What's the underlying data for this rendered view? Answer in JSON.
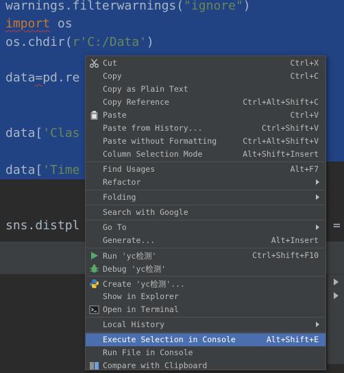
{
  "editor": {
    "lines": [
      {
        "parts": [
          {
            "t": "warnings.filterwarnings(",
            "c": ""
          },
          {
            "t": "\"ignore\"",
            "c": "str"
          },
          {
            "t": ")",
            "c": ""
          }
        ]
      },
      {
        "parts": [
          {
            "t": "import",
            "c": "kw"
          },
          {
            "t": " os",
            "c": ""
          }
        ]
      },
      {
        "parts": [
          {
            "t": "os.chdir(",
            "c": ""
          },
          {
            "t": "r'C:/Data'",
            "c": "str"
          },
          {
            "t": ")",
            "c": ""
          }
        ]
      },
      {
        "parts": [
          {
            "t": "data",
            "c": ""
          },
          {
            "t": "=",
            "c": "squig"
          },
          {
            "t": "pd.re",
            "c": ""
          }
        ]
      },
      {
        "parts": [
          {
            "t": "data[",
            "c": ""
          },
          {
            "t": "'Clas",
            "c": "str"
          }
        ]
      },
      {
        "parts": [
          {
            "t": "data[",
            "c": ""
          },
          {
            "t": "'Time",
            "c": "str"
          }
        ]
      },
      {
        "parts": [
          {
            "t": "sns.distpl",
            "c": ""
          }
        ]
      }
    ],
    "right_fragment": "="
  },
  "context_menu": {
    "items": [
      {
        "name": "menu-item-cut",
        "icon": "scissors-icon",
        "label": "Cut",
        "mnemonic": "t",
        "shortcut": "Ctrl+X"
      },
      {
        "name": "menu-item-copy",
        "icon": "",
        "label": "Copy",
        "mnemonic": "C",
        "shortcut": "Ctrl+C"
      },
      {
        "name": "menu-item-copy-plain-text",
        "icon": "",
        "label": "Copy as Plain Text",
        "shortcut": ""
      },
      {
        "name": "menu-item-copy-reference",
        "icon": "",
        "label": "Copy Reference",
        "mnemonic": "y",
        "shortcut": "Ctrl+Alt+Shift+C"
      },
      {
        "name": "menu-item-paste",
        "icon": "clipboard-icon",
        "label": "Paste",
        "mnemonic": "P",
        "shortcut": "Ctrl+V"
      },
      {
        "name": "menu-item-paste-from-history",
        "icon": "",
        "label": "Paste from History...",
        "mnemonic": "e",
        "shortcut": "Ctrl+Shift+V"
      },
      {
        "name": "menu-item-paste-without-formatting",
        "icon": "",
        "label": "Paste without Formatting",
        "mnemonic": "w",
        "shortcut": "Ctrl+Alt+Shift+V"
      },
      {
        "name": "menu-item-column-selection-mode",
        "icon": "",
        "label": "Column Selection Mode",
        "mnemonic": "M",
        "shortcut": "Alt+Shift+Insert"
      },
      {
        "sep": true
      },
      {
        "name": "menu-item-find-usages",
        "icon": "",
        "label": "Find Usages",
        "mnemonic": "U",
        "shortcut": "Alt+F7"
      },
      {
        "name": "menu-item-refactor",
        "icon": "",
        "label": "Refactor",
        "mnemonic": "R",
        "shortcut": "",
        "submenu": true
      },
      {
        "sep": true
      },
      {
        "name": "menu-item-folding",
        "icon": "",
        "label": "Folding",
        "shortcut": "",
        "submenu": true
      },
      {
        "sep": true
      },
      {
        "name": "menu-item-search-with-google",
        "icon": "",
        "label": "Search with Google",
        "mnemonic": "S",
        "shortcut": ""
      },
      {
        "sep": true
      },
      {
        "name": "menu-item-go-to",
        "icon": "",
        "label": "Go To",
        "mnemonic": "G",
        "shortcut": "",
        "submenu": true
      },
      {
        "name": "menu-item-generate",
        "icon": "",
        "label": "Generate...",
        "mnemonic": "G",
        "shortcut": "Alt+Insert"
      },
      {
        "sep": true
      },
      {
        "name": "menu-item-run",
        "icon": "run-icon",
        "label": "Run 'yc检测'",
        "mnemonic": "u",
        "shortcut": "Ctrl+Shift+F10"
      },
      {
        "name": "menu-item-debug",
        "icon": "debug-bug-icon",
        "label": "Debug 'yc检测'",
        "mnemonic": "D",
        "shortcut": ""
      },
      {
        "sep": true
      },
      {
        "name": "menu-item-create",
        "icon": "python-icon",
        "label": "Create 'yc检测'...",
        "shortcut": ""
      },
      {
        "name": "menu-item-show-in-explorer",
        "icon": "",
        "label": "Show in Explorer",
        "shortcut": ""
      },
      {
        "name": "menu-item-open-in-terminal",
        "icon": "terminal-icon",
        "label": "Open in Terminal",
        "shortcut": ""
      },
      {
        "sep": true
      },
      {
        "name": "menu-item-local-history",
        "icon": "",
        "label": "Local History",
        "mnemonic": "H",
        "shortcut": "",
        "submenu": true
      },
      {
        "sep": true
      },
      {
        "name": "menu-item-execute-selection-in-console",
        "icon": "",
        "label": "Execute Selection in Console",
        "shortcut": "Alt+Shift+E",
        "highlighted": true
      },
      {
        "name": "menu-item-run-file-in-console",
        "icon": "",
        "label": "Run File in Console",
        "shortcut": ""
      },
      {
        "name": "menu-item-compare-with-clipboard",
        "icon": "compare-icon",
        "label": "Compare with Clipboard",
        "mnemonic": "b",
        "shortcut": ""
      }
    ]
  },
  "colors": {
    "editor_bg": "#2b2b2b",
    "selection": "#214283",
    "menu_bg": "#3c3f41",
    "menu_highlight": "#4b6eaf",
    "keyword": "#cc7832",
    "string": "#6a8759"
  }
}
